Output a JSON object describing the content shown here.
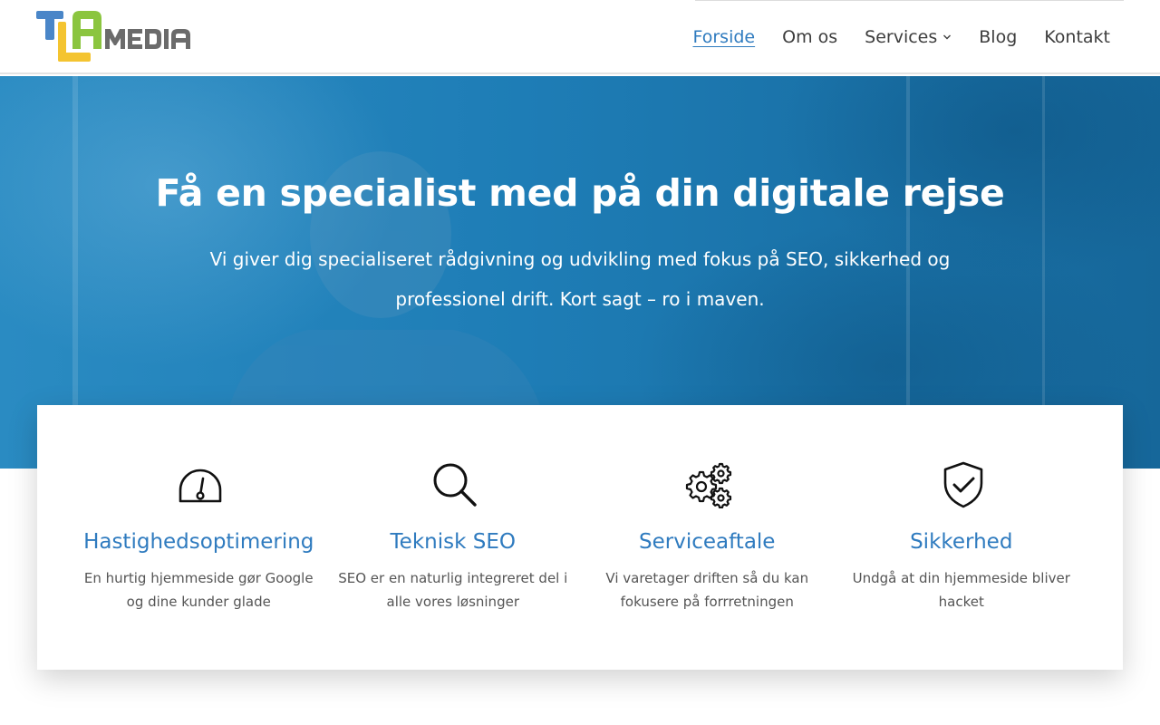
{
  "logo": {
    "letters_primary": "TLA",
    "letters_secondary": "MEDIA",
    "colors": {
      "t": "#4a86c8",
      "l": "#f4c430",
      "a": "#8bc53f",
      "media": "#6b6b6b"
    }
  },
  "nav": {
    "items": [
      {
        "label": "Forside",
        "active": true
      },
      {
        "label": "Om os"
      },
      {
        "label": "Services",
        "has_dropdown": true
      },
      {
        "label": "Blog"
      },
      {
        "label": "Kontakt"
      }
    ]
  },
  "hero": {
    "title": "Få en specialist med på din digitale rejse",
    "subtitle": "Vi giver dig specialiseret rådgivning og udvikling med fokus på SEO, sikkerhed og professionel drift. Kort sagt – ro i maven."
  },
  "services": [
    {
      "icon": "speedometer-icon",
      "title": "Hastighedsoptimering",
      "text": "En hurtig hjemmeside gør Google og dine kunder glade"
    },
    {
      "icon": "magnifier-icon",
      "title": "Teknisk SEO",
      "text": "SEO er en naturlig integreret del i alle vores løsninger"
    },
    {
      "icon": "gears-icon",
      "title": "Serviceaftale",
      "text": "Vi varetager driften så du kan fokusere på forrretningen"
    },
    {
      "icon": "shield-check-icon",
      "title": "Sikkerhed",
      "text": "Undgå at din hjemmeside bliver hacket"
    }
  ],
  "colors": {
    "accent": "#2f7bbf",
    "hero_blue": "#1e7db6"
  }
}
